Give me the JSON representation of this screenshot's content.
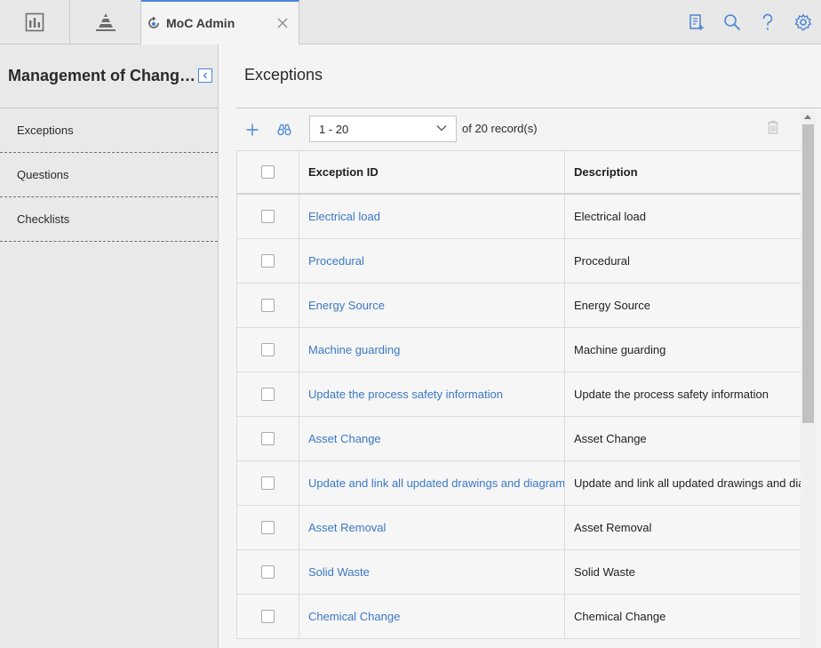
{
  "topbar": {
    "tabs": [
      {
        "icon": "dashboard-icon"
      },
      {
        "icon": "pyramid-icon"
      }
    ],
    "active_tab": {
      "label": "MoC Admin",
      "icon": "moc-refresh-icon"
    },
    "right_icons": [
      "new-record-icon",
      "search-icon",
      "help-icon",
      "gear-icon"
    ]
  },
  "sidebar": {
    "title": "Management of Change Administration",
    "items": [
      {
        "label": "Exceptions"
      },
      {
        "label": "Questions"
      },
      {
        "label": "Checklists"
      }
    ]
  },
  "main": {
    "title": "Exceptions",
    "pager": {
      "selected": "1 - 20",
      "suffix": "of 20 record(s)"
    },
    "grid": {
      "columns": [
        "Exception ID",
        "Description"
      ],
      "rows": [
        {
          "id": "Electrical load",
          "description": "Electrical load"
        },
        {
          "id": "Procedural",
          "description": "Procedural"
        },
        {
          "id": "Energy Source",
          "description": "Energy Source"
        },
        {
          "id": "Machine guarding",
          "description": "Machine guarding"
        },
        {
          "id": "Update the process safety information",
          "description": "Update the process safety information"
        },
        {
          "id": "Asset Change",
          "description": "Asset Change"
        },
        {
          "id": "Update and link all updated drawings and diagrams",
          "description": "Update and link all updated drawings and diagr"
        },
        {
          "id": "Asset Removal",
          "description": "Asset Removal"
        },
        {
          "id": "Solid Waste",
          "description": "Solid Waste"
        },
        {
          "id": "Chemical Change",
          "description": "Chemical Change"
        }
      ]
    }
  },
  "colors": {
    "accent": "#4a86d6",
    "link": "#3b78c4"
  }
}
